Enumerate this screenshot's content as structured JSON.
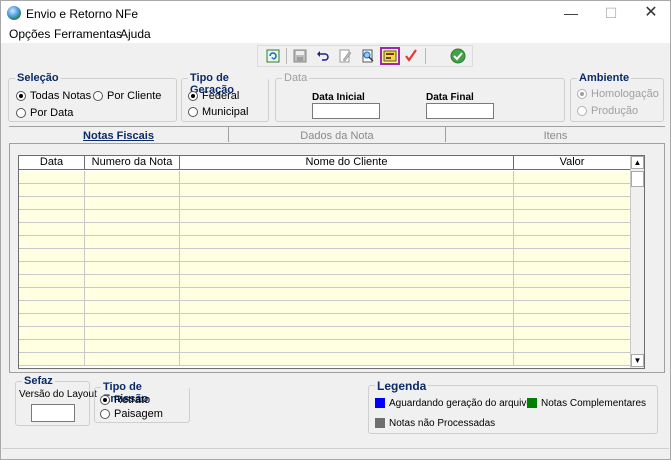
{
  "window": {
    "title": "Envio e Retorno NFe"
  },
  "menu": [
    {
      "label": "Opções"
    },
    {
      "label": "Ferramentas"
    },
    {
      "label": "Ajuda"
    }
  ],
  "selecao": {
    "title": "Seleção",
    "options": [
      "Todas Notas",
      "Por Cliente",
      "Por Data"
    ],
    "selected": "Todas Notas"
  },
  "tipo_geracao": {
    "title": "Tipo de Geração",
    "options": [
      "Federal",
      "Municipal"
    ],
    "selected": "Federal"
  },
  "data": {
    "title": "Data",
    "inicial_label": "Data Inicial",
    "final_label": "Data Final",
    "inicial_value": "",
    "final_value": ""
  },
  "ambiente": {
    "title": "Ambiente",
    "options": [
      "Homologação",
      "Produção"
    ],
    "selected": "Homologação"
  },
  "tabs": [
    {
      "label": "Notas Fiscais",
      "active": true
    },
    {
      "label": "Dados da Nota",
      "active": false
    },
    {
      "label": "Itens",
      "active": false
    }
  ],
  "grid": {
    "columns": [
      "Data",
      "Numero da Nota",
      "Nome do Cliente",
      "Valor"
    ],
    "row_count": 15
  },
  "sefaz": {
    "title": "Sefaz",
    "versao_label": "Versão do Layout",
    "versao_value": ""
  },
  "tipo_emissao": {
    "title": "Tipo de Emissão",
    "options": [
      "Retrato",
      "Paisagem"
    ],
    "selected": "Retrato"
  },
  "legenda": {
    "title": "Legenda",
    "items": [
      {
        "label": "Aguardando geração do arquivo",
        "color": "#0000ff"
      },
      {
        "label": "Notas Complementares",
        "color": "#008000"
      },
      {
        "label": "Notas não Processadas",
        "color": "#6e6e6e"
      }
    ]
  },
  "colors": {
    "group_title": "#0b2a66",
    "row_bg": "#ffffe1",
    "highlight_border": "#9c27b0"
  },
  "toolbar_icons": [
    "refresh-icon",
    "save-icon",
    "undo-icon",
    "edit-icon",
    "search-doc-icon",
    "generate-icon",
    "checkmark-icon",
    "ok-circle-icon"
  ]
}
